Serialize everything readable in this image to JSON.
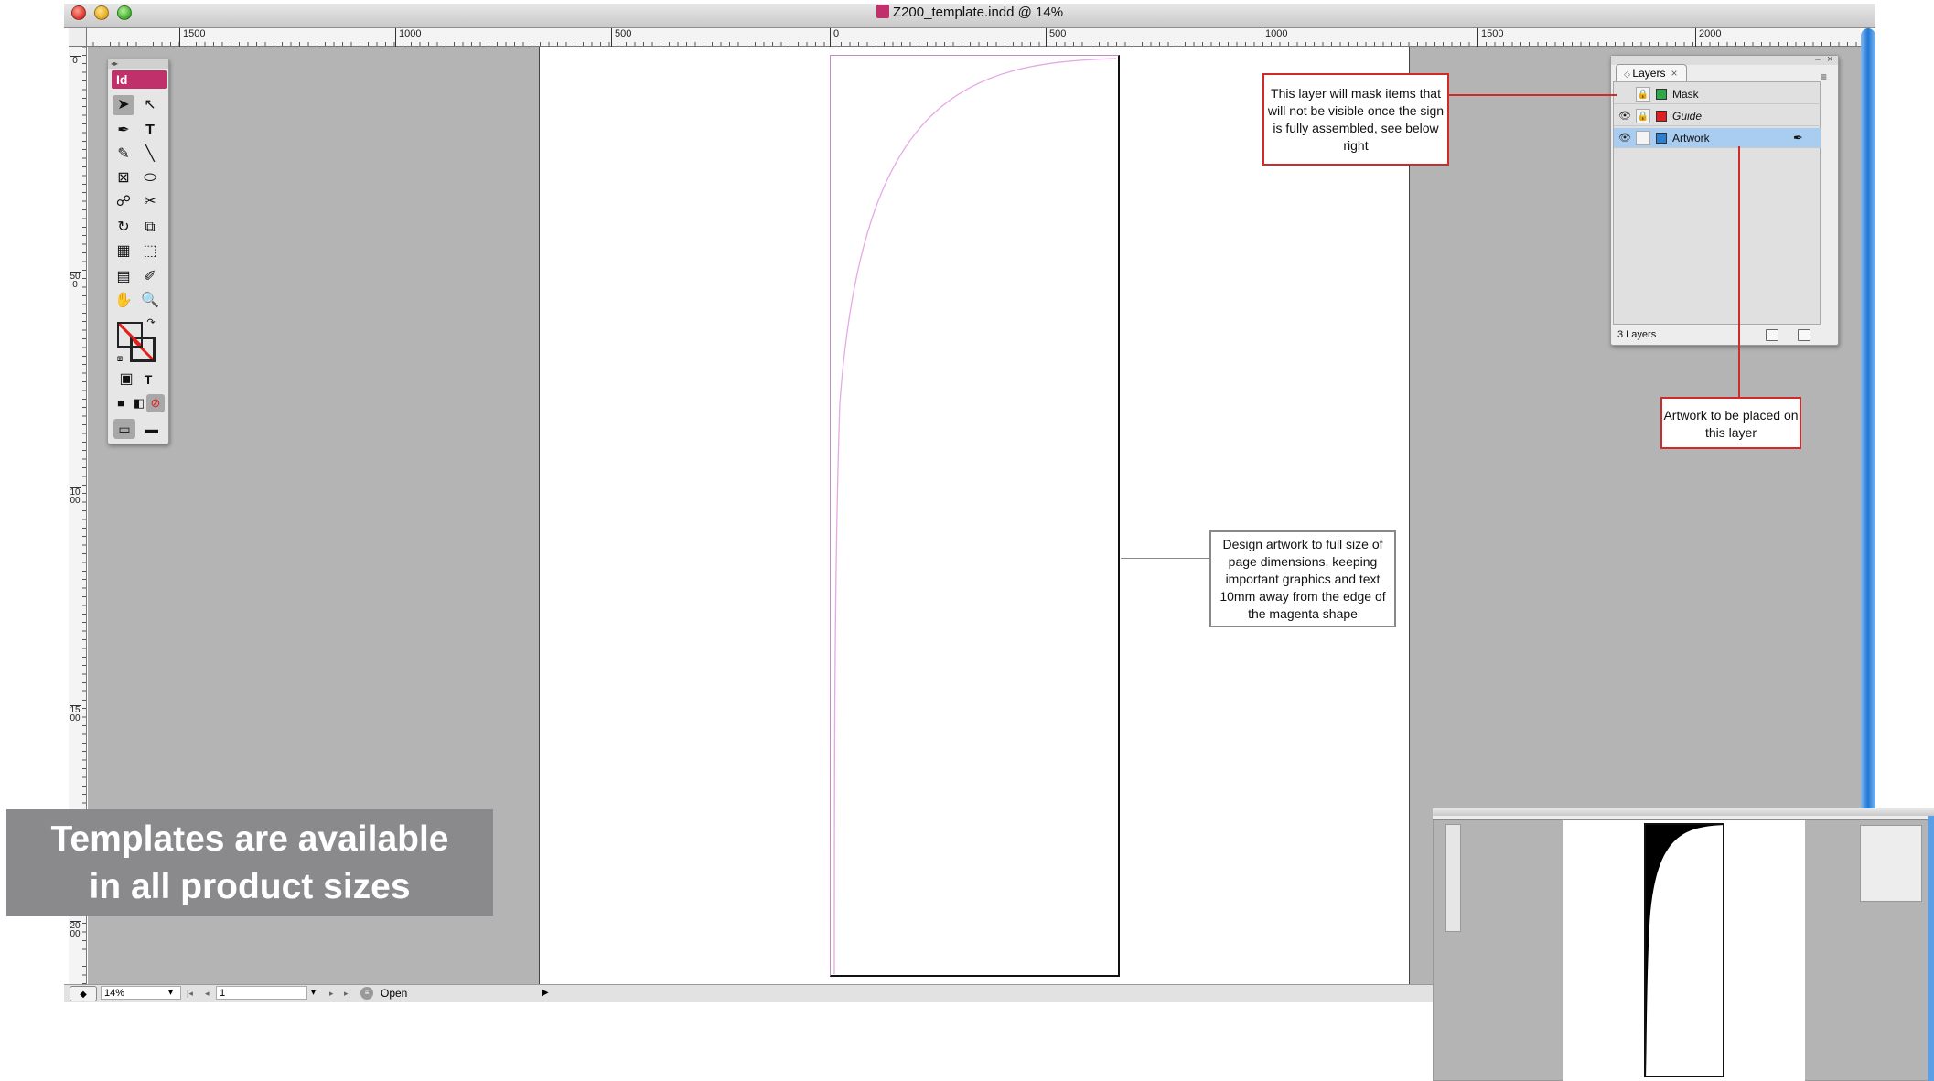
{
  "window": {
    "title": "Z200_template.indd @ 14%"
  },
  "rulers": {
    "horizontal": [
      "1500",
      "1000",
      "500",
      "0",
      "500",
      "1000",
      "1500",
      "2000"
    ],
    "vertical": [
      "0",
      "500",
      "1000",
      "1500",
      "2000"
    ]
  },
  "tools_panel": {
    "logo": "Id"
  },
  "layers_panel": {
    "tab_label": "Layers",
    "layers": [
      {
        "name": "Mask",
        "color": "#2fa84a",
        "visible": false,
        "locked": true,
        "italic": false
      },
      {
        "name": "Guide",
        "color": "#e02020",
        "visible": true,
        "locked": true,
        "italic": true
      },
      {
        "name": "Artwork",
        "color": "#2f7fd0",
        "visible": true,
        "locked": false,
        "selected": true,
        "italic": false
      }
    ],
    "footer_count": "3 Layers"
  },
  "status_bar": {
    "zoom": "14%",
    "page": "1",
    "status": "Open"
  },
  "callouts": {
    "mask": "This layer will mask items that will not be visible once the sign is fully assembled, see below right",
    "artwork": "Artwork to be placed on this layer",
    "design": "Design artwork to full size of page dimensions, keeping important graphics and text 10mm away from the edge of the magenta shape"
  },
  "banner": {
    "line1": "Templates are available",
    "line2": "in all product sizes"
  },
  "colors": {
    "callout_border": "#d02a2a",
    "magenta_guide": "#d36bd3",
    "id_brand": "#c0306a",
    "banner_bg": "#8a8a8d"
  }
}
